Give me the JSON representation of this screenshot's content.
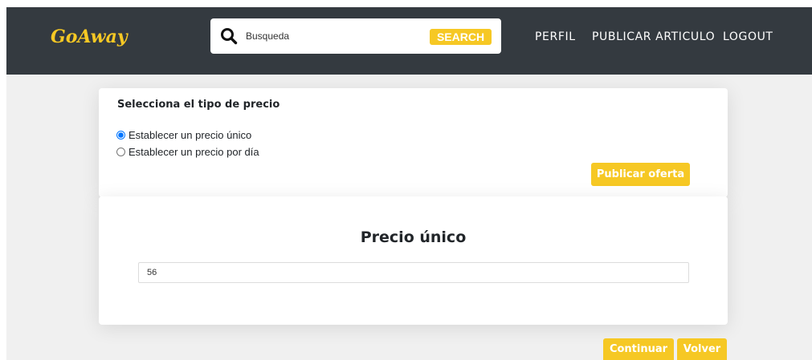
{
  "navbar": {
    "logo": "GoAway",
    "search": {
      "placeholder": "Busqueda",
      "value": "",
      "button_label": "SEARCH",
      "icon": "search-icon"
    },
    "links": [
      "PERFIL",
      "PUBLICAR ARTICULO",
      "LOGOUT"
    ]
  },
  "price_type": {
    "title": "Selecciona el tipo de precio",
    "options": [
      {
        "label": "Establecer un precio único",
        "selected": true
      },
      {
        "label": "Establecer un precio por día",
        "selected": false
      }
    ],
    "publish_button": "Publicar oferta"
  },
  "unique_price": {
    "title": "Precio único",
    "value": "56"
  },
  "actions": {
    "continue": "Continuar",
    "back": "Volver"
  },
  "colors": {
    "navbar": "#343a40",
    "accent": "#f6c824",
    "page_bg": "#f0f0f0"
  }
}
